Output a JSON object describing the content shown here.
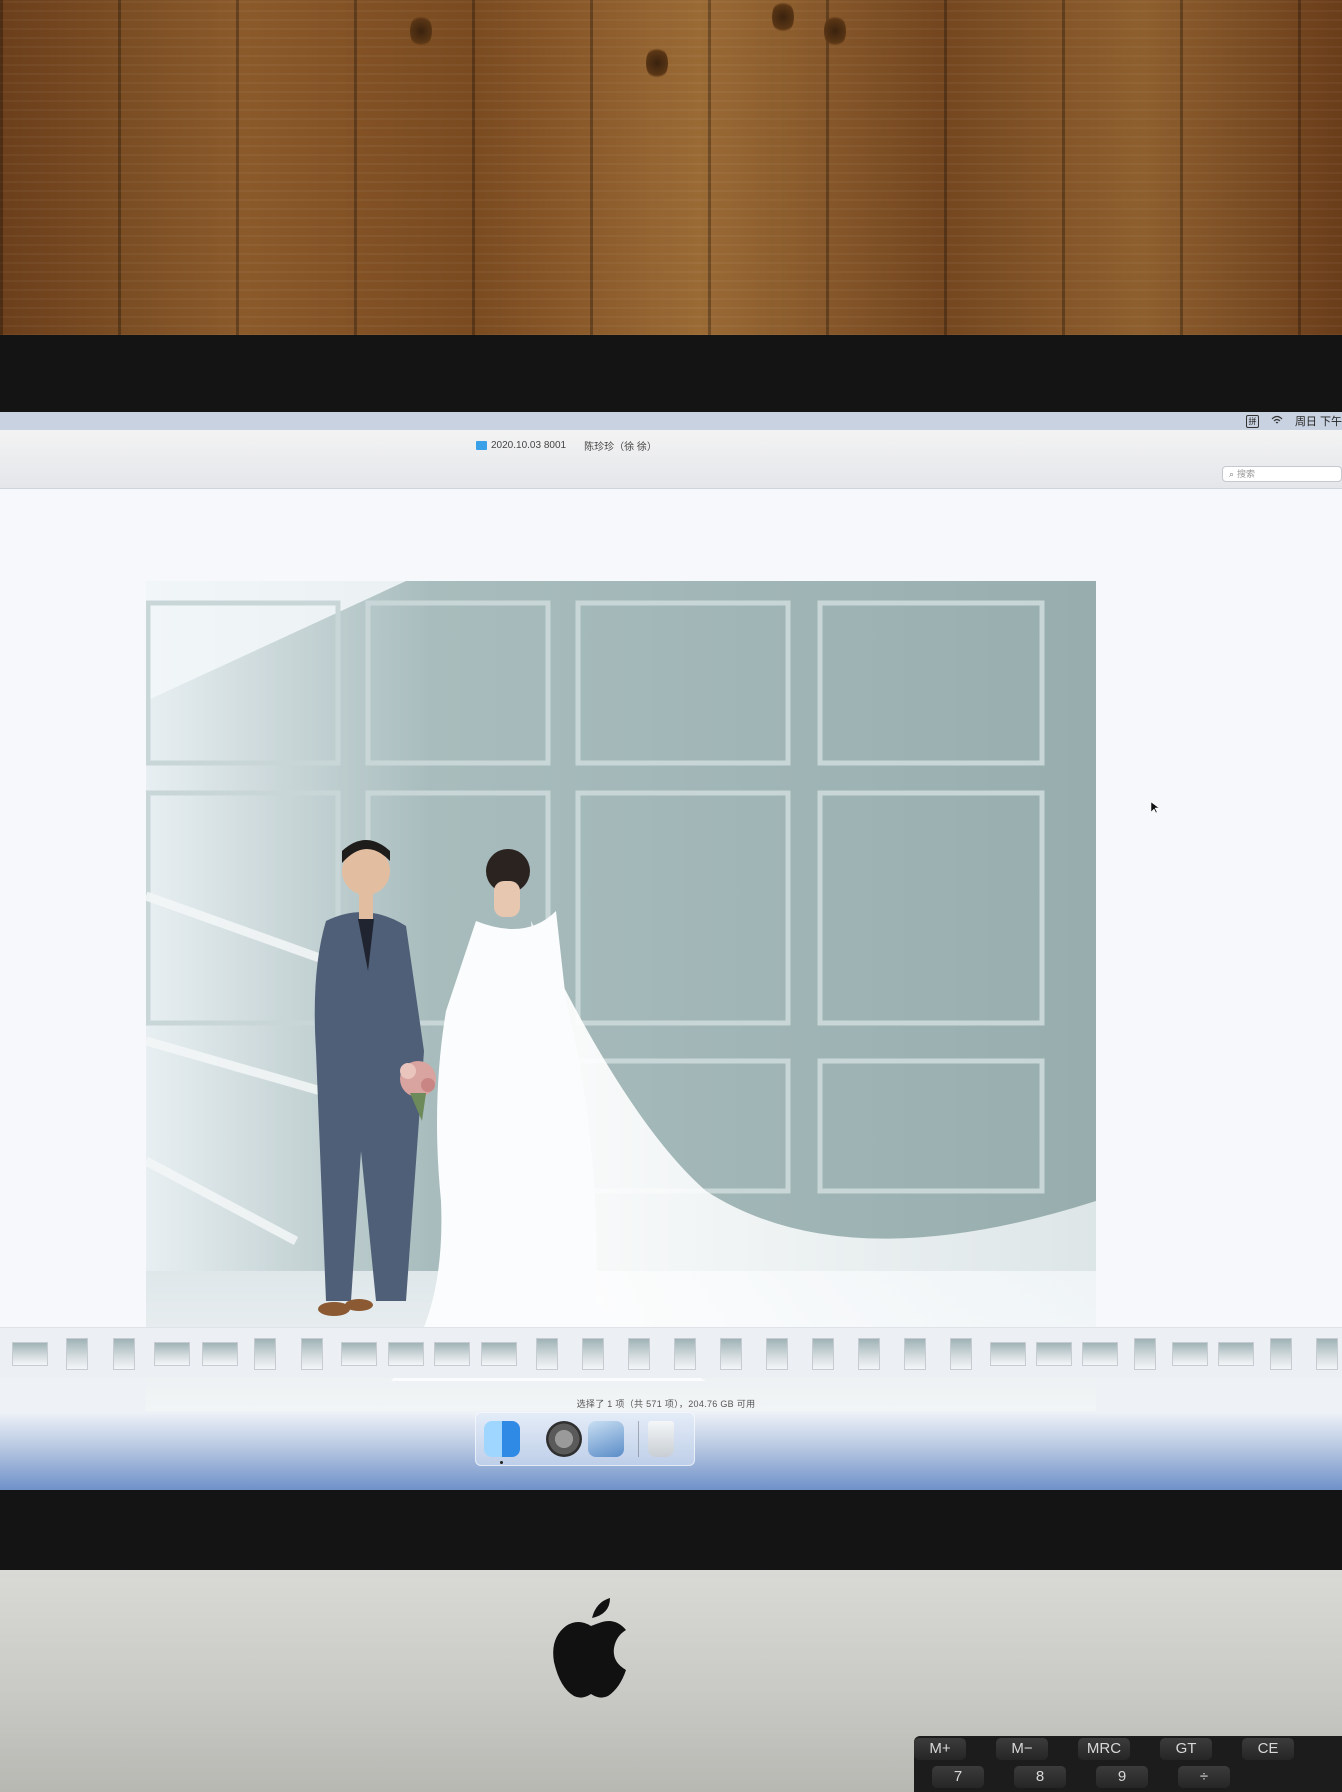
{
  "menubar": {
    "clock": "周日 下午"
  },
  "window": {
    "folder_name": "2020.10.03 8001",
    "subtitle": "陈珍珍（徐 徐）",
    "search_placeholder": "搜索"
  },
  "status_bar": {
    "text": "选择了 1 项（共 571 项），204.76 GB 可用"
  },
  "dock": {
    "items": [
      "finder-icon",
      "system-preferences-icon",
      "preview-icon",
      "trash-icon"
    ]
  },
  "calculator": {
    "keys_top": [
      "M+",
      "M−",
      "MRC",
      "GT",
      "CE"
    ],
    "keys_bottom": [
      "7",
      "8",
      "9",
      "÷"
    ]
  },
  "colors": {
    "accent_folder": "#3aa0e8",
    "dock_gradient_bottom": "#6f91c9"
  }
}
